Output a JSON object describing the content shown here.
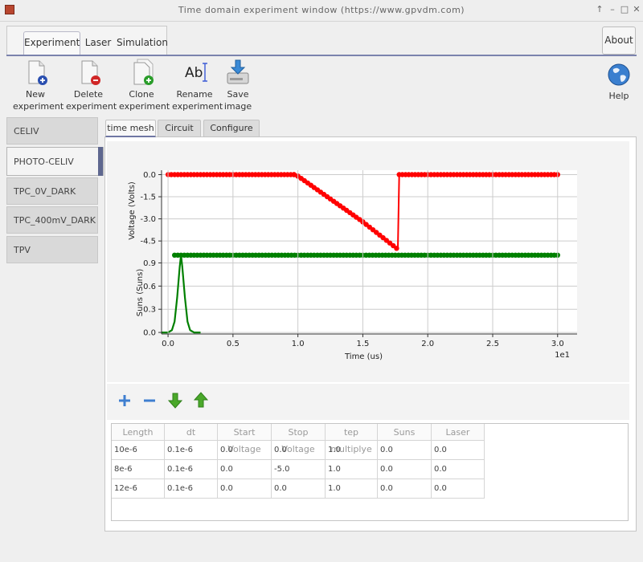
{
  "window": {
    "title": "Time domain experiment window (https://www.gpvdm.com)",
    "controls": [
      "↑",
      "–",
      "□",
      "✕"
    ]
  },
  "main_tabs": [
    "Experiment",
    "Laser",
    "Simulation"
  ],
  "about_label": "About",
  "toolbar": [
    {
      "line1": "New",
      "line2": "experiment",
      "icon": "new-experiment-icon"
    },
    {
      "line1": "Delete",
      "line2": "experiment",
      "icon": "delete-experiment-icon"
    },
    {
      "line1": "Clone",
      "line2": "experiment",
      "icon": "clone-experiment-icon"
    },
    {
      "line1": "Rename",
      "line2": "experiment",
      "icon": "rename-icon"
    },
    {
      "line1": "Save",
      "line2": "image",
      "icon": "save-icon"
    }
  ],
  "help_label": "Help",
  "sidebar": [
    "CELIV",
    "PHOTO-CELIV",
    "TPC_0V_DARK",
    "TPC_400mV_DARK",
    "TPV"
  ],
  "sidebar_active": 1,
  "sub_tabs": [
    "time mesh",
    "Circuit",
    "Configure"
  ],
  "chart_data": {
    "type": "line",
    "xlabel": "Time (us)",
    "x_multiplier": "1e1",
    "xlim": [
      -0.05,
      3.15
    ],
    "xticks": [
      "0.0",
      "0.5",
      "1.0",
      "1.5",
      "2.0",
      "2.5",
      "3.0"
    ],
    "colors": {
      "voltage": "#ff0000",
      "suns": "#008000"
    },
    "top": {
      "ylabel": "Voltage (Volts)",
      "ylim": [
        -5.2,
        0.3
      ],
      "yticks": [
        "0.0",
        "-1.5",
        "-3.0",
        "-4.5"
      ],
      "x": [
        0.0,
        0.5,
        0.97,
        1.0,
        1.5,
        1.76,
        1.77,
        1.78,
        2.0,
        2.5,
        3.0
      ],
      "y": [
        0.0,
        0.0,
        0.0,
        -0.1,
        -3.2,
        -5.0,
        -5.0,
        0.0,
        0.0,
        0.0,
        0.0
      ]
    },
    "bottom": {
      "ylabel": "Suns (Suns)",
      "ylim": [
        -0.02,
        1.05
      ],
      "yticks": [
        "0.0",
        "0.3",
        "0.6",
        "0.9"
      ],
      "suns": {
        "x": [
          0.05,
          0.5,
          1.0,
          1.5,
          2.0,
          2.5,
          3.0
        ],
        "y": [
          1.0,
          1.0,
          1.0,
          1.0,
          1.0,
          1.0,
          1.0
        ]
      },
      "pulse": {
        "x": [
          -0.05,
          0.0,
          0.03,
          0.05,
          0.07,
          0.09,
          0.1,
          0.11,
          0.13,
          0.15,
          0.17,
          0.2,
          0.25
        ],
        "y": [
          0.0,
          0.0,
          0.03,
          0.14,
          0.45,
          0.85,
          1.0,
          0.85,
          0.45,
          0.14,
          0.03,
          0.0,
          0.0
        ]
      }
    }
  },
  "table": {
    "headers": [
      "Length",
      "dt",
      "Start Voltage",
      "Stop Voltage",
      "tep multiplye",
      "Suns",
      "Laser"
    ],
    "rows": [
      [
        "10e-6",
        "0.1e-6",
        "0.0",
        "0.0",
        "1.0",
        "0.0",
        "0.0"
      ],
      [
        "8e-6",
        "0.1e-6",
        "0.0",
        "-5.0",
        "1.0",
        "0.0",
        "0.0"
      ],
      [
        "12e-6",
        "0.1e-6",
        "0.0",
        "0.0",
        "1.0",
        "0.0",
        "0.0"
      ]
    ]
  }
}
